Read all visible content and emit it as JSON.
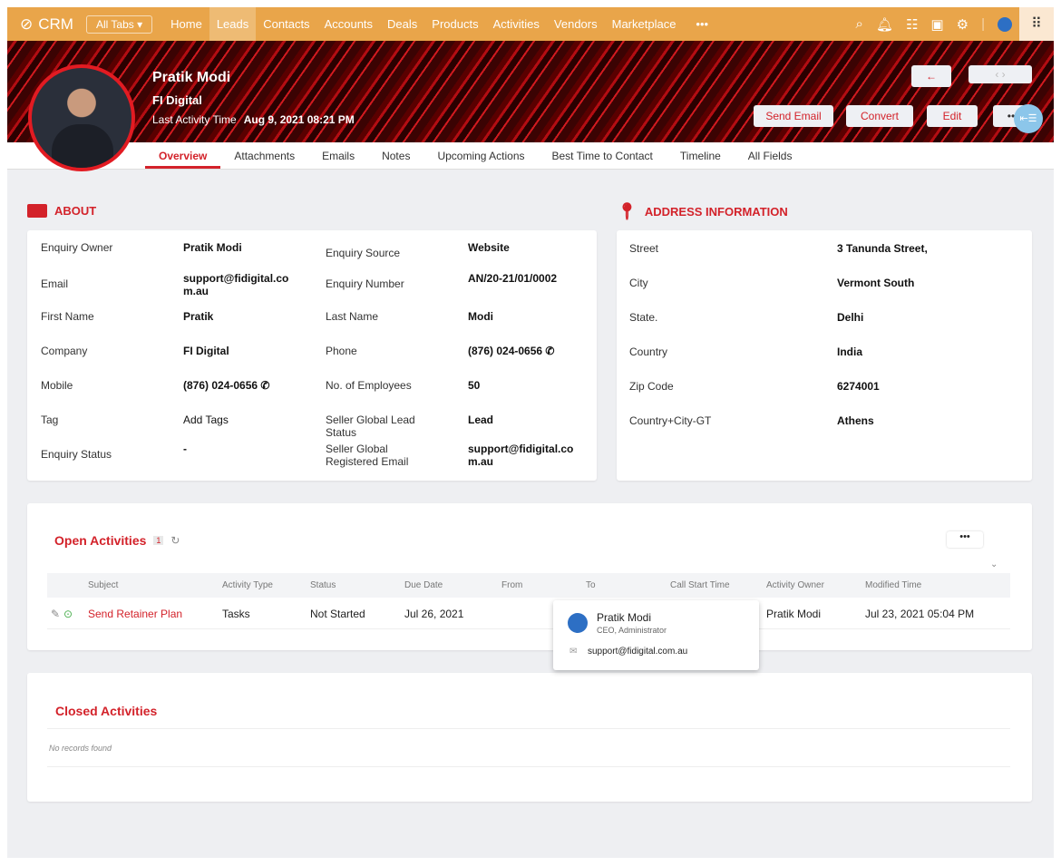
{
  "nav": {
    "app_name": "CRM",
    "all_tabs": "All Tabs ▾",
    "items": [
      "Home",
      "Leads",
      "Contacts",
      "Accounts",
      "Deals",
      "Products",
      "Activities",
      "Vendors",
      "Marketplace",
      "•••"
    ],
    "active": "Leads",
    "icons": [
      "search-icon",
      "bell-icon",
      "add-note-icon",
      "calendar-icon",
      "gear-icon",
      "profile-avatar-icon",
      "app-grid-icon"
    ]
  },
  "header": {
    "name": "Pratik Modi",
    "company": "FI Digital",
    "last_activity_label": "Last Activity Time",
    "last_activity_value": "Aug 9, 2021 08:21 PM",
    "buttons": {
      "back": "←",
      "prev_next": "‹  ›",
      "send_email": "Send Email",
      "convert": "Convert",
      "edit": "Edit",
      "more": "••"
    }
  },
  "tabs": [
    "Overview",
    "Attachments",
    "Emails",
    "Notes",
    "Upcoming Actions",
    "Best Time to Contact",
    "Timeline",
    "All Fields"
  ],
  "about": {
    "title": "ABOUT",
    "left": [
      [
        "Enquiry Owner",
        "Pratik Modi"
      ],
      [
        "Email",
        "support@fidigital.co m.au"
      ],
      [
        "First Name",
        "Pratik"
      ],
      [
        "Company",
        "FI Digital"
      ],
      [
        "Mobile",
        "(876) 024-0656 ✆"
      ],
      [
        "Tag",
        "Add Tags"
      ],
      [
        "Enquiry Status",
        "-"
      ]
    ],
    "right": [
      [
        "Enquiry Source",
        "Website"
      ],
      [
        "Enquiry Number",
        "AN/20-21/01/0002"
      ],
      [
        "Last Name",
        "Modi"
      ],
      [
        "Phone",
        "(876) 024-0656 ✆"
      ],
      [
        "No. of Employees",
        "50"
      ],
      [
        "Seller Global Lead Status",
        "Lead"
      ],
      [
        "Seller Global Registered Email",
        "support@fidigital.co m.au"
      ]
    ]
  },
  "address": {
    "title": "ADDRESS INFORMATION",
    "rows": [
      [
        "Street",
        "3 Tanunda Street,"
      ],
      [
        "City",
        "Vermont South"
      ],
      [
        "State.",
        "Delhi"
      ],
      [
        "Country",
        "India"
      ],
      [
        "Zip Code",
        "6274001"
      ],
      [
        "Country+City-GT",
        "Athens"
      ]
    ]
  },
  "open_activities": {
    "title": "Open Activities",
    "count": "1",
    "more": "•••",
    "columns": [
      "Subject",
      "Activity Type",
      "Status",
      "Due Date",
      "From",
      "To",
      "Call Start Time",
      "Activity Owner",
      "Modified Time"
    ],
    "rows": [
      {
        "subject": "Send Retainer Plan",
        "type": "Tasks",
        "status": "Not Started",
        "due": "Jul 26, 2021",
        "from": "",
        "to": "",
        "call_start": "",
        "owner": "Pratik Modi",
        "modified": "Jul 23, 2021 05:04 PM"
      }
    ]
  },
  "popup": {
    "name": "Pratik Modi",
    "role": "CEO, Administrator",
    "email": "support@fidigital.com.au"
  },
  "closed_activities": {
    "title": "Closed Activities",
    "empty": "No records found"
  },
  "colors": {
    "nav": "#e9a54a",
    "accent": "#d3222a",
    "bg": "#eeeff2"
  }
}
